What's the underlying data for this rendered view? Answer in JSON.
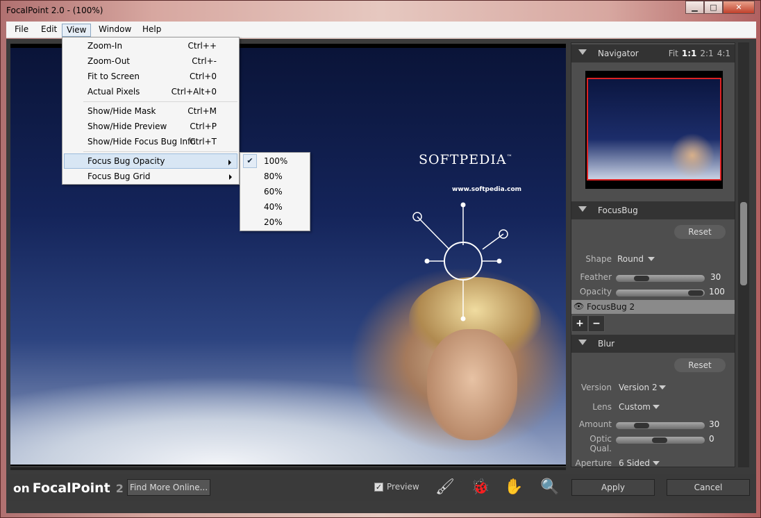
{
  "window": {
    "title": "FocalPoint 2.0 -  (100%)",
    "controls": [
      "minimize",
      "maximize",
      "close"
    ]
  },
  "menubar": [
    "File",
    "Edit",
    "View",
    "Window",
    "Help"
  ],
  "view_menu": {
    "groups": [
      [
        {
          "label": "Zoom-In",
          "shortcut": "Ctrl++"
        },
        {
          "label": "Zoom-Out",
          "shortcut": "Ctrl+-"
        },
        {
          "label": "Fit to Screen",
          "shortcut": "Ctrl+0"
        },
        {
          "label": "Actual Pixels",
          "shortcut": "Ctrl+Alt+0"
        }
      ],
      [
        {
          "label": "Show/Hide Mask",
          "shortcut": "Ctrl+M"
        },
        {
          "label": "Show/Hide Preview",
          "shortcut": "Ctrl+P"
        },
        {
          "label": "Show/Hide Focus Bug Info",
          "shortcut": "Ctrl+T"
        }
      ],
      [
        {
          "label": "Focus Bug Opacity",
          "shortcut": ""
        },
        {
          "label": "Focus Bug Grid",
          "shortcut": ""
        }
      ]
    ],
    "opacity_submenu": {
      "options": [
        "100%",
        "80%",
        "60%",
        "40%",
        "20%"
      ],
      "selected": "100%"
    }
  },
  "canvas": {
    "logo_text": "SOFTPEDIA",
    "tm": "™",
    "url": "www.softpedia.com"
  },
  "navigator": {
    "title": "Navigator",
    "zoom": [
      "Fit",
      "1:1",
      "2:1",
      "4:1"
    ],
    "active_zoom": "1:1"
  },
  "focusbug": {
    "title": "FocusBug",
    "reset": "Reset",
    "shape_label": "Shape",
    "shape_value": "Round",
    "feather_label": "Feather",
    "feather_value": "30",
    "feather_level": 0.3,
    "opacity_label": "Opacity",
    "opacity_value": "100",
    "opacity_level": 1.0,
    "bug_name": "FocusBug 2",
    "plus": "+",
    "minus": "−"
  },
  "blur": {
    "title": "Blur",
    "reset": "Reset",
    "version_label": "Version",
    "version_value": "Version 2",
    "lens_label": "Lens",
    "lens_value": "Custom",
    "amount_label": "Amount",
    "amount_value": "30",
    "amount_level": 0.3,
    "optic_label": "Optic Qual.",
    "optic_value": "0",
    "optic_level": 0.5,
    "aperture_label": "Aperture",
    "aperture_value": "6 Sided"
  },
  "bottom": {
    "brand_on": "on",
    "brand": "FocalPoint",
    "brand_num": "2",
    "find_more": "Find More Online...",
    "preview_label": "Preview",
    "preview_checked": true,
    "apply": "Apply",
    "cancel": "Cancel"
  }
}
